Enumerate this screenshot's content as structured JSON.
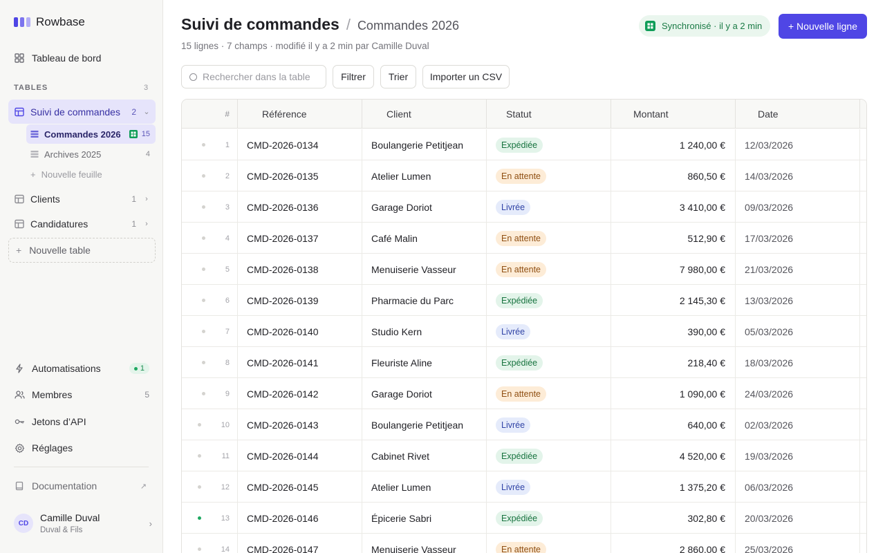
{
  "app": {
    "name": "Rowbase"
  },
  "sidebar": {
    "dashboard": "Tableau de bord",
    "section_label": "TABLES",
    "section_count": "3",
    "tables": [
      {
        "label": "Suivi de commandes",
        "count": "2"
      },
      {
        "label": "Clients",
        "count": "1"
      },
      {
        "label": "Candidatures",
        "count": "1"
      }
    ],
    "sheets": [
      {
        "label": "Commandes 2026",
        "count": "15"
      },
      {
        "label": "Archives 2025",
        "count": "4"
      }
    ],
    "new_sheet": "Nouvelle feuille",
    "new_table": "Nouvelle table",
    "bottom": {
      "automations": "Automatisations",
      "automations_badge": "1",
      "members": "Membres",
      "members_count": "5",
      "api_tokens": "Jetons d’API",
      "settings": "Réglages",
      "docs": "Documentation"
    },
    "user": {
      "initials": "CD",
      "name": "Camille Duval",
      "org": "Duval & Fils"
    }
  },
  "header": {
    "title": "Suivi de commandes",
    "separator": "/",
    "subtitle_sheet": "Commandes 2026",
    "meta": "15 lignes · 7 champs · modifié il y a 2 min par Camille Duval",
    "sync": "Synchronisé · il y a 2 min",
    "new_row": "+ Nouvelle ligne"
  },
  "toolbar": {
    "search_placeholder": "Rechercher dans la table",
    "filter": "Filtrer",
    "sort": "Trier",
    "import": "Importer un CSV"
  },
  "table": {
    "columns": {
      "num": "#",
      "ref": "Référence",
      "client": "Client",
      "status": "Statut",
      "amount": "Montant",
      "date": "Date"
    },
    "rows": [
      {
        "n": "1",
        "ref": "CMD-2026-0134",
        "client": "Boulangerie Petitjean",
        "status": "Expédiée",
        "amount": "1 240,00 €",
        "date": "12/03/2026"
      },
      {
        "n": "2",
        "ref": "CMD-2026-0135",
        "client": "Atelier Lumen",
        "status": "En attente",
        "amount": "860,50 €",
        "date": "14/03/2026"
      },
      {
        "n": "3",
        "ref": "CMD-2026-0136",
        "client": "Garage Doriot",
        "status": "Livrée",
        "amount": "3 410,00 €",
        "date": "09/03/2026"
      },
      {
        "n": "4",
        "ref": "CMD-2026-0137",
        "client": "Café Malin",
        "status": "En attente",
        "amount": "512,90 €",
        "date": "17/03/2026"
      },
      {
        "n": "5",
        "ref": "CMD-2026-0138",
        "client": "Menuiserie Vasseur",
        "status": "En attente",
        "amount": "7 980,00 €",
        "date": "21/03/2026"
      },
      {
        "n": "6",
        "ref": "CMD-2026-0139",
        "client": "Pharmacie du Parc",
        "status": "Expédiée",
        "amount": "2 145,30 €",
        "date": "13/03/2026"
      },
      {
        "n": "7",
        "ref": "CMD-2026-0140",
        "client": "Studio Kern",
        "status": "Livrée",
        "amount": "390,00 €",
        "date": "05/03/2026"
      },
      {
        "n": "8",
        "ref": "CMD-2026-0141",
        "client": "Fleuriste Aline",
        "status": "Expédiée",
        "amount": "218,40 €",
        "date": "18/03/2026"
      },
      {
        "n": "9",
        "ref": "CMD-2026-0142",
        "client": "Garage Doriot",
        "status": "En attente",
        "amount": "1 090,00 €",
        "date": "24/03/2026"
      },
      {
        "n": "10",
        "ref": "CMD-2026-0143",
        "client": "Boulangerie Petitjean",
        "status": "Livrée",
        "amount": "640,00 €",
        "date": "02/03/2026"
      },
      {
        "n": "11",
        "ref": "CMD-2026-0144",
        "client": "Cabinet Rivet",
        "status": "Expédiée",
        "amount": "4 520,00 €",
        "date": "19/03/2026"
      },
      {
        "n": "12",
        "ref": "CMD-2026-0145",
        "client": "Atelier Lumen",
        "status": "Livrée",
        "amount": "1 375,20 €",
        "date": "06/03/2026"
      },
      {
        "n": "13",
        "ref": "CMD-2026-0146",
        "client": "Épicerie Sabri",
        "status": "Expédiée",
        "amount": "302,80 €",
        "date": "20/03/2026"
      },
      {
        "n": "14",
        "ref": "CMD-2026-0147",
        "client": "Menuiserie Vasseur",
        "status": "En attente",
        "amount": "2 860,00 €",
        "date": "25/03/2026"
      }
    ]
  },
  "colors": {
    "accent": "#4f46e5",
    "sync_green": "#0f9d58",
    "expediee": "#e3f4ea",
    "en_attente": "#fdecd7",
    "livree": "#e5ebfb"
  }
}
